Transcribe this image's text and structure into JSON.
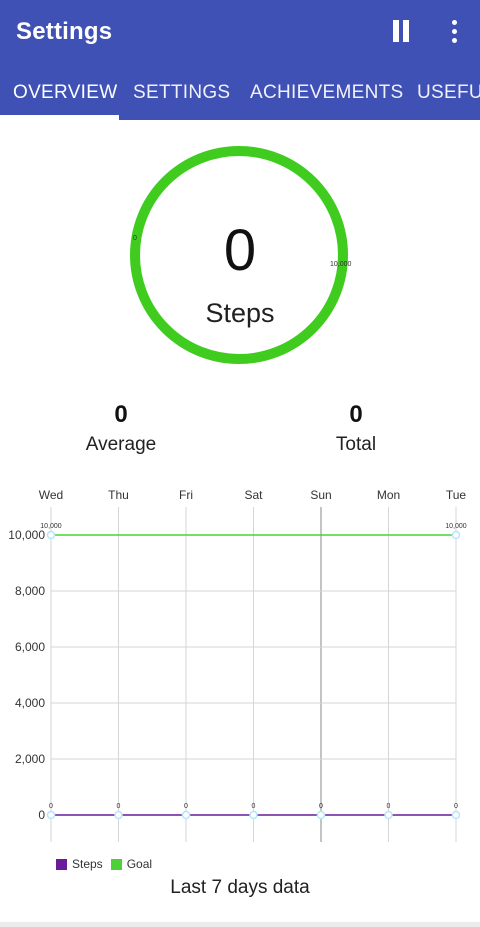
{
  "app_bar": {
    "title": "Settings",
    "pause_icon": "pause-icon",
    "menu_icon": "more-vert-icon"
  },
  "tabs": [
    {
      "label": "OVERVIEW",
      "active": true
    },
    {
      "label": "SETTINGS",
      "active": false
    },
    {
      "label": "ACHIEVEMENTS",
      "active": false
    },
    {
      "label": "USEFUL",
      "active": false
    }
  ],
  "progress_ring": {
    "value": "0",
    "label": "Steps",
    "min_label": "0",
    "max_label": "10,000",
    "fraction": 0,
    "color": "#3fcc1f"
  },
  "stats": {
    "average_value": "0",
    "average_label": "Average",
    "total_value": "0",
    "total_label": "Total"
  },
  "chart_data": {
    "type": "line",
    "x": [
      "Wed",
      "Thu",
      "Fri",
      "Sat",
      "Sun",
      "Mon",
      "Tue"
    ],
    "ylim": [
      0,
      10000
    ],
    "y_ticks": [
      "0",
      "2,000",
      "4,000",
      "6,000",
      "8,000",
      "10,000"
    ],
    "series": [
      {
        "name": "Steps",
        "values": [
          0,
          0,
          0,
          0,
          0,
          0,
          0
        ],
        "color": "#6a1b9a",
        "point_labels": [
          "0",
          "0",
          "0",
          "0",
          "0",
          "0",
          "0"
        ]
      },
      {
        "name": "Goal",
        "values": [
          10000,
          10000
        ],
        "x_index": [
          0,
          6
        ],
        "color": "#4cd137",
        "point_labels": [
          "10,000",
          "10,000"
        ]
      }
    ],
    "grid": true,
    "legend": "bottom-left",
    "caption": "Last 7 days data"
  },
  "colors": {
    "app_bar": "#3f51b5",
    "steps": "#6a1b9a",
    "goal": "#4cd137",
    "point": "#b3e5fc"
  }
}
